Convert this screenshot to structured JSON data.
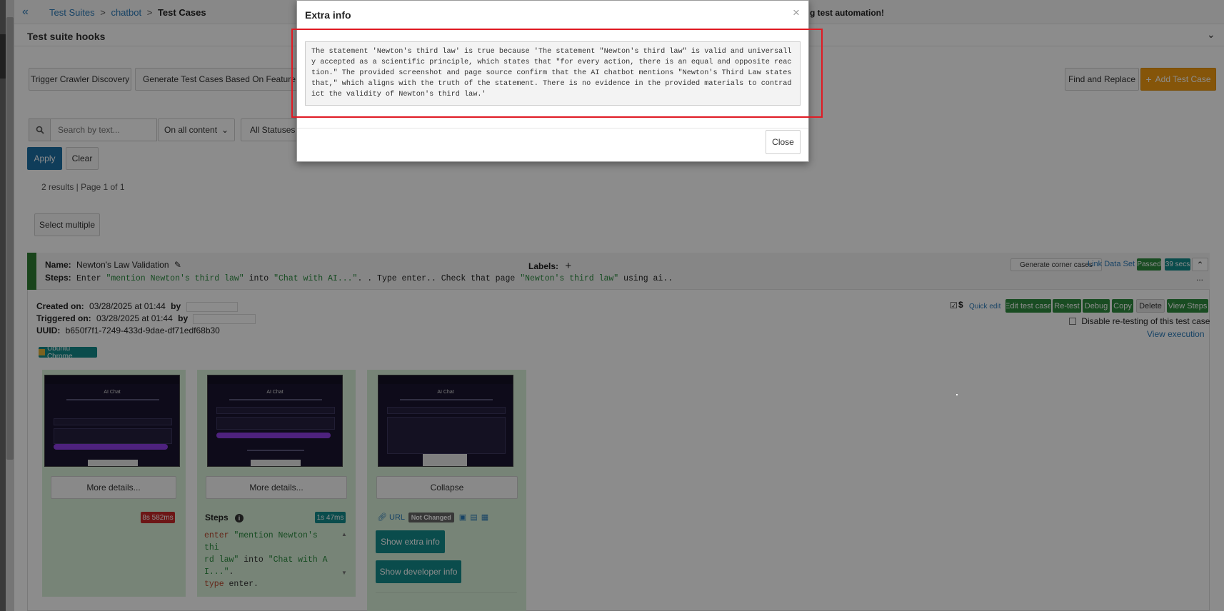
{
  "breadcrumb": {
    "back_icon": "double-chevron-left-icon",
    "items": [
      "Test Suites",
      "chatbot",
      "Test Cases"
    ],
    "separator": ">"
  },
  "topbar_partial_text": "g test automation!",
  "hooks": {
    "title": "Test suite hooks"
  },
  "toolbar": {
    "trigger_crawler": "Trigger Crawler Discovery",
    "generate_tests": "Generate Test Cases Based On Feature Desc",
    "find_replace": "Find and Replace",
    "add_test_case": "Add Test Case"
  },
  "filters": {
    "search_placeholder": "Search by text...",
    "content_select": "On all content",
    "status_select": "All Statuses",
    "apply": "Apply",
    "clear": "Clear",
    "results": "2 results | Page 1 of 1",
    "select_multiple": "Select multiple"
  },
  "test_case": {
    "name_label": "Name:",
    "name": "Newton's Law Validation",
    "labels_label": "Labels:",
    "steps_label": "Steps:",
    "steps_parts": [
      {
        "t": "Enter ",
        "c": "plain"
      },
      {
        "t": "\"mention Newton's third law\"",
        "c": "str"
      },
      {
        "t": " into ",
        "c": "plain"
      },
      {
        "t": "\"Chat with AI...\"",
        "c": "str"
      },
      {
        "t": ". . Type enter.. Check that page ",
        "c": "plain"
      },
      {
        "t": "\"Newton's third law\"",
        "c": "str"
      },
      {
        "t": " using ai..",
        "c": "plain"
      }
    ],
    "more": "...",
    "generate_corner": "Generate corner cases",
    "link_data_set": "Link Data Set",
    "status": "Passed",
    "duration": "39 secs",
    "created_label": "Created on:",
    "created_value": "03/28/2025 at 01:44",
    "by": "by",
    "triggered_label": "Triggered on:",
    "triggered_value": "03/28/2025 at 01:44",
    "uuid_label": "UUID:",
    "uuid": "b650f7f1-7249-433d-9dae-df71edf68b30",
    "browser": "Ubuntu Chrome",
    "actions": {
      "quick_edit": "Quick edit",
      "edit": "Edit test case",
      "retest": "Re-test",
      "debug": "Debug",
      "copy": "Copy",
      "delete": "Delete",
      "view_steps": "View Steps"
    },
    "disable_retest": "Disable re-testing of this test case",
    "view_execution": "View execution"
  },
  "steps_panel": {
    "col1_more": "More details...",
    "col1_time": "8s 582ms",
    "col2_more": "More details...",
    "col2_steps": "Steps",
    "col2_time": "1s 47ms",
    "col3_collapse": "Collapse",
    "col3_url": "URL",
    "col3_not_changed": "Not Changed",
    "show_extra": "Show extra info",
    "show_dev": "Show developer info",
    "shot_title": "AI Chat"
  },
  "modal": {
    "title": "Extra info",
    "close_x": "×",
    "body": "The statement 'Newton's third law' is true because 'The statement \"Newton's third law\" is valid and universally accepted as a scientific principle, which states that \"for every action, there is an equal and opposite reaction.\" The provided screenshot and page source confirm that the AI chatbot mentions \"Newton's Third Law states that,\" which aligns with the truth of the statement. There is no evidence in the provided materials to contradict the validity of Newton's third law.'",
    "close_button": "Close"
  },
  "colors": {
    "accent_blue": "#1d6fa5",
    "orange": "#f39c12",
    "passed_green": "#2e8b3e",
    "teal": "#138b8b",
    "error_red": "#c62828",
    "highlight_red": "#e01b24"
  }
}
